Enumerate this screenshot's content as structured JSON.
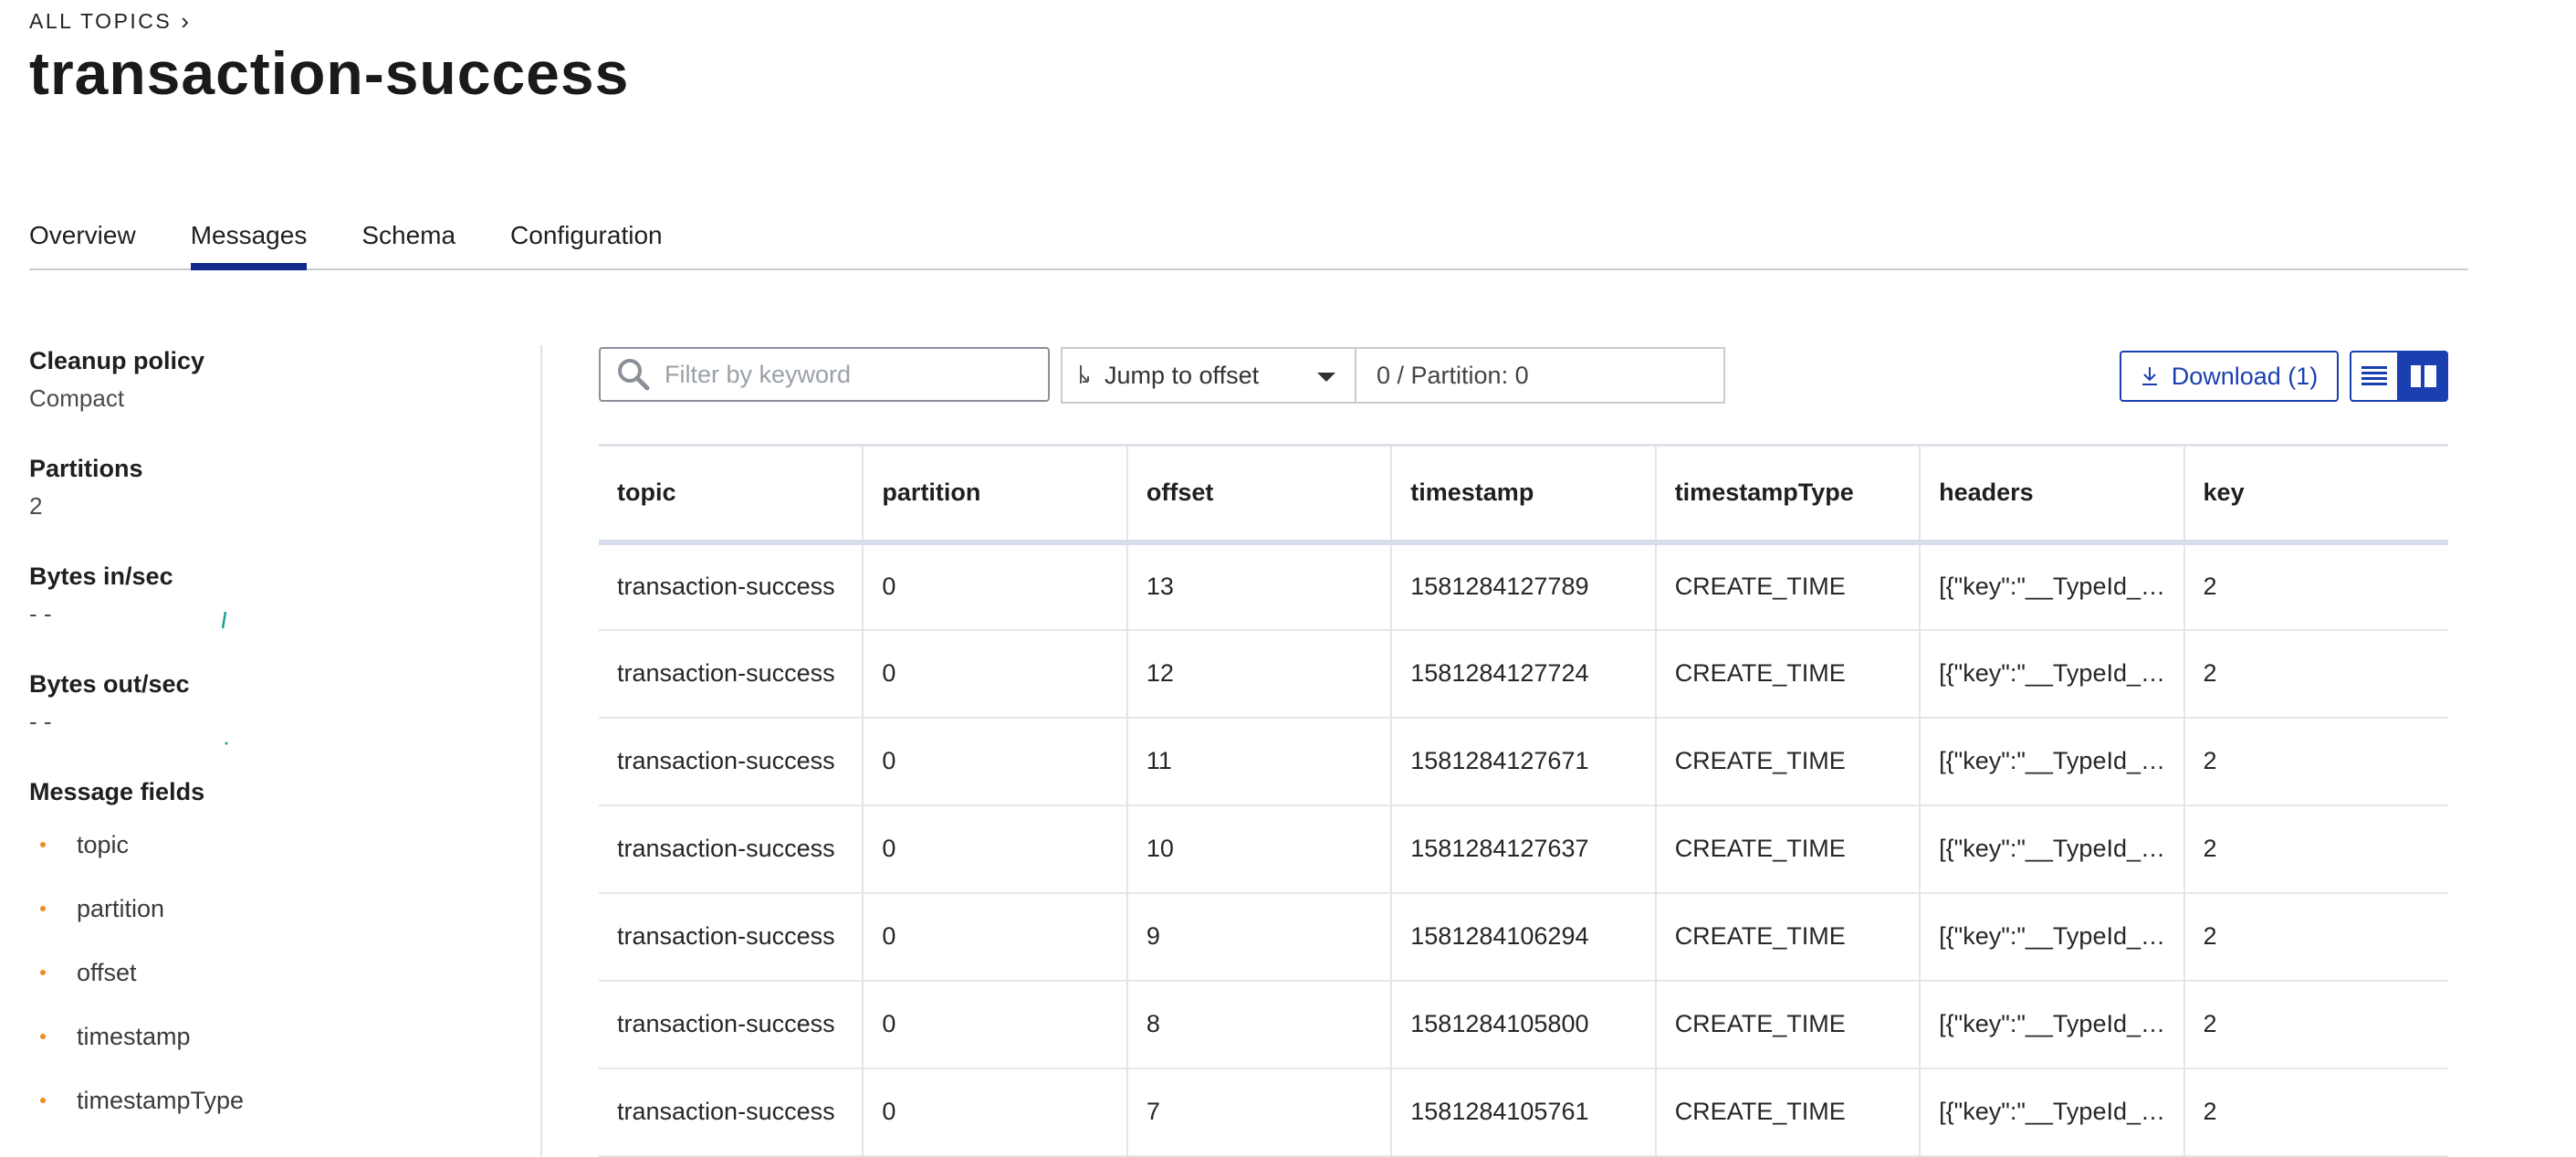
{
  "breadcrumb": {
    "label": "ALL TOPICS",
    "chevron": "chevron-right-icon"
  },
  "title": "transaction-success",
  "tabs": [
    {
      "label": "Overview",
      "active": false
    },
    {
      "label": "Messages",
      "active": true
    },
    {
      "label": "Schema",
      "active": false
    },
    {
      "label": "Configuration",
      "active": false
    }
  ],
  "sidebar": {
    "cleanup_policy": {
      "label": "Cleanup policy",
      "value": "Compact"
    },
    "partitions": {
      "label": "Partitions",
      "value": "2"
    },
    "bytes_in": {
      "label": "Bytes in/sec",
      "value": "- -"
    },
    "bytes_out": {
      "label": "Bytes out/sec",
      "value": "- -"
    },
    "message_fields": {
      "label": "Message fields",
      "items": [
        "topic",
        "partition",
        "offset",
        "timestamp",
        "timestampType"
      ]
    }
  },
  "toolbar": {
    "search_placeholder": "Filter by keyword",
    "jump_label": "Jump to offset",
    "offset_value": "0 / Partition: 0",
    "download_label": "Download (1)"
  },
  "colors": {
    "accent": "#1a3fb0",
    "active_tab": "#0f2a8a",
    "bullet": "#f28b24",
    "spark": "#1aa39a"
  },
  "table": {
    "columns": [
      "topic",
      "partition",
      "offset",
      "timestamp",
      "timestampType",
      "headers",
      "key"
    ],
    "rows": [
      [
        "transaction-success",
        "0",
        "13",
        "1581284127789",
        "CREATE_TIME",
        "[{\"key\":\"__TypeId__\",...",
        "2"
      ],
      [
        "transaction-success",
        "0",
        "12",
        "1581284127724",
        "CREATE_TIME",
        "[{\"key\":\"__TypeId__\",...",
        "2"
      ],
      [
        "transaction-success",
        "0",
        "11",
        "1581284127671",
        "CREATE_TIME",
        "[{\"key\":\"__TypeId__\",...",
        "2"
      ],
      [
        "transaction-success",
        "0",
        "10",
        "1581284127637",
        "CREATE_TIME",
        "[{\"key\":\"__TypeId__\",...",
        "2"
      ],
      [
        "transaction-success",
        "0",
        "9",
        "1581284106294",
        "CREATE_TIME",
        "[{\"key\":\"__TypeId__\",...",
        "2"
      ],
      [
        "transaction-success",
        "0",
        "8",
        "1581284105800",
        "CREATE_TIME",
        "[{\"key\":\"__TypeId__\",...",
        "2"
      ],
      [
        "transaction-success",
        "0",
        "7",
        "1581284105761",
        "CREATE_TIME",
        "[{\"key\":\"__TypeId__\",...",
        "2"
      ]
    ]
  }
}
